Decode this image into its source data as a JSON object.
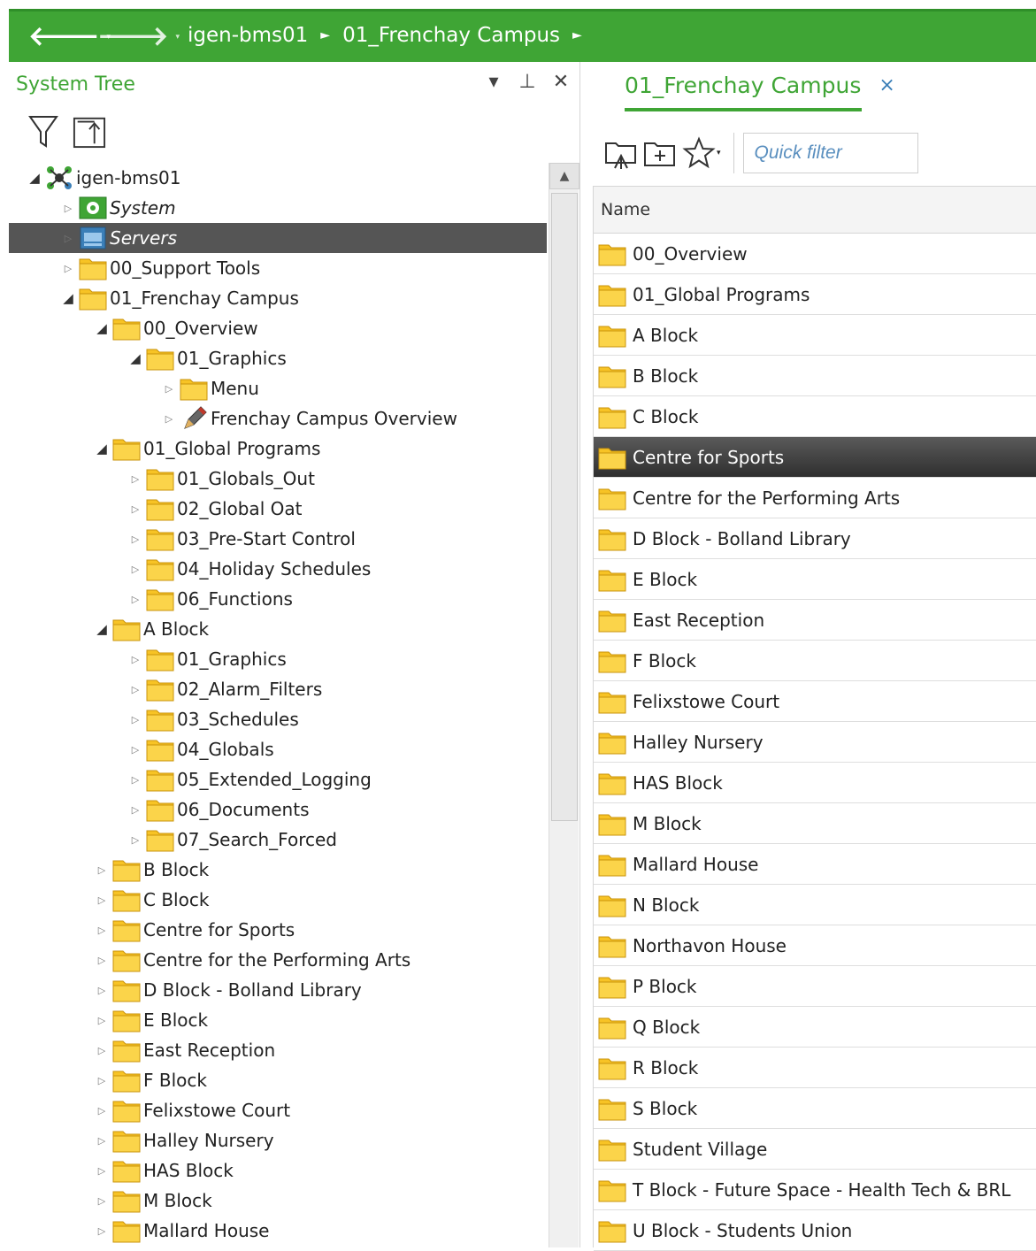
{
  "nav": {
    "back_icon": "arrow-left-icon",
    "forward_icon": "arrow-right-icon",
    "dropdown_glyph": "▾",
    "back_arrow": "🡐",
    "forward_arrow": "🡒",
    "breadcrumbs": [
      "igen-bms01",
      "01_Frenchay Campus"
    ],
    "separator": "►"
  },
  "left_panel": {
    "title": "System Tree",
    "controls": [
      "▾",
      "⊥",
      "✕"
    ],
    "toolbar": [
      "filter-icon",
      "collapse-all-icon"
    ],
    "tree": [
      {
        "label": "igen-bms01",
        "level": 0,
        "expanded": true,
        "icon": "server-network-icon"
      },
      {
        "label": "System",
        "level": 1,
        "expanded": false,
        "icon": "system-icon",
        "italic": true
      },
      {
        "label": "Servers",
        "level": 1,
        "expanded": false,
        "icon": "servers-icon",
        "italic": true,
        "selected": true
      },
      {
        "label": "00_Support Tools",
        "level": 1,
        "expanded": false,
        "icon": "folder-icon"
      },
      {
        "label": "01_Frenchay Campus",
        "level": 1,
        "expanded": true,
        "icon": "folder-icon"
      },
      {
        "label": "00_Overview",
        "level": 2,
        "expanded": true,
        "icon": "folder-icon"
      },
      {
        "label": "01_Graphics",
        "level": 3,
        "expanded": true,
        "icon": "folder-icon"
      },
      {
        "label": "Menu",
        "level": 4,
        "expanded": false,
        "icon": "folder-icon"
      },
      {
        "label": "Frenchay Campus Overview",
        "level": 4,
        "expanded": false,
        "icon": "graphic-pen-icon"
      },
      {
        "label": "01_Global Programs",
        "level": 2,
        "expanded": true,
        "icon": "folder-icon"
      },
      {
        "label": "01_Globals_Out",
        "level": 3,
        "expanded": false,
        "icon": "folder-icon"
      },
      {
        "label": "02_Global Oat",
        "level": 3,
        "expanded": false,
        "icon": "folder-icon"
      },
      {
        "label": "03_Pre-Start Control",
        "level": 3,
        "expanded": false,
        "icon": "folder-icon"
      },
      {
        "label": "04_Holiday Schedules",
        "level": 3,
        "expanded": false,
        "icon": "folder-icon"
      },
      {
        "label": "06_Functions",
        "level": 3,
        "expanded": false,
        "icon": "folder-icon"
      },
      {
        "label": "A Block",
        "level": 2,
        "expanded": true,
        "icon": "folder-icon"
      },
      {
        "label": "01_Graphics",
        "level": 3,
        "expanded": false,
        "icon": "folder-icon"
      },
      {
        "label": "02_Alarm_Filters",
        "level": 3,
        "expanded": false,
        "icon": "folder-icon"
      },
      {
        "label": "03_Schedules",
        "level": 3,
        "expanded": false,
        "icon": "folder-icon"
      },
      {
        "label": "04_Globals",
        "level": 3,
        "expanded": false,
        "icon": "folder-icon"
      },
      {
        "label": "05_Extended_Logging",
        "level": 3,
        "expanded": false,
        "icon": "folder-icon"
      },
      {
        "label": "06_Documents",
        "level": 3,
        "expanded": false,
        "icon": "folder-icon"
      },
      {
        "label": "07_Search_Forced",
        "level": 3,
        "expanded": false,
        "icon": "folder-icon"
      },
      {
        "label": "B Block",
        "level": 2,
        "expanded": false,
        "icon": "folder-icon"
      },
      {
        "label": "C Block",
        "level": 2,
        "expanded": false,
        "icon": "folder-icon"
      },
      {
        "label": "Centre for Sports",
        "level": 2,
        "expanded": false,
        "icon": "folder-icon"
      },
      {
        "label": "Centre for the Performing Arts",
        "level": 2,
        "expanded": false,
        "icon": "folder-icon"
      },
      {
        "label": "D Block - Bolland Library",
        "level": 2,
        "expanded": false,
        "icon": "folder-icon"
      },
      {
        "label": "E Block",
        "level": 2,
        "expanded": false,
        "icon": "folder-icon"
      },
      {
        "label": "East Reception",
        "level": 2,
        "expanded": false,
        "icon": "folder-icon"
      },
      {
        "label": "F Block",
        "level": 2,
        "expanded": false,
        "icon": "folder-icon"
      },
      {
        "label": "Felixstowe Court",
        "level": 2,
        "expanded": false,
        "icon": "folder-icon"
      },
      {
        "label": "Halley Nursery",
        "level": 2,
        "expanded": false,
        "icon": "folder-icon"
      },
      {
        "label": "HAS Block",
        "level": 2,
        "expanded": false,
        "icon": "folder-icon"
      },
      {
        "label": "M Block",
        "level": 2,
        "expanded": false,
        "icon": "folder-icon"
      },
      {
        "label": "Mallard House",
        "level": 2,
        "expanded": false,
        "icon": "folder-icon"
      }
    ]
  },
  "right_panel": {
    "tab_label": "01_Frenchay Campus",
    "tab_close": "×",
    "toolbar": [
      "folder-up-icon",
      "new-folder-icon",
      "favorites-star-icon"
    ],
    "star_dropdown": "▾",
    "quick_filter_placeholder": "Quick filter",
    "quick_filter_value": "",
    "column_header": "Name",
    "rows": [
      {
        "label": "00_Overview"
      },
      {
        "label": "01_Global Programs"
      },
      {
        "label": "A Block"
      },
      {
        "label": "B Block"
      },
      {
        "label": "C Block"
      },
      {
        "label": "Centre for Sports",
        "selected": true
      },
      {
        "label": "Centre for the Performing Arts"
      },
      {
        "label": "D Block - Bolland Library"
      },
      {
        "label": "E Block"
      },
      {
        "label": "East Reception"
      },
      {
        "label": "F Block"
      },
      {
        "label": "Felixstowe Court"
      },
      {
        "label": "Halley Nursery"
      },
      {
        "label": "HAS Block"
      },
      {
        "label": "M Block"
      },
      {
        "label": "Mallard House"
      },
      {
        "label": "N Block"
      },
      {
        "label": "Northavon House"
      },
      {
        "label": "P Block"
      },
      {
        "label": "Q Block"
      },
      {
        "label": "R Block"
      },
      {
        "label": "S Block"
      },
      {
        "label": "Student Village"
      },
      {
        "label": "T Block - Future Space - Health Tech & BRL"
      },
      {
        "label": "U Block - Students Union"
      }
    ]
  },
  "colors": {
    "accent_green": "#3fa535",
    "selection_dark": "#555555",
    "folder_yellow": "#f7c325",
    "link_blue": "#3b7fb8"
  }
}
